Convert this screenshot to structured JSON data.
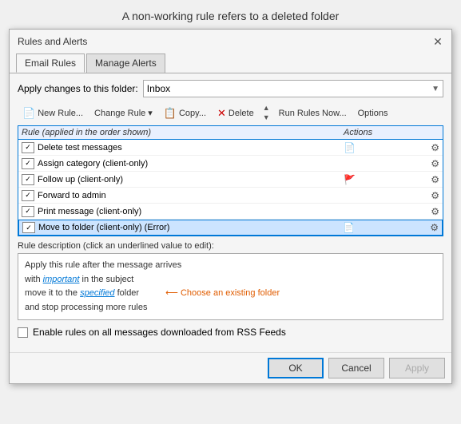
{
  "page": {
    "title": "A non-working rule refers to a deleted folder"
  },
  "dialog": {
    "title": "Rules and Alerts",
    "close_label": "✕"
  },
  "tabs": [
    {
      "id": "email-rules",
      "label": "Email Rules",
      "active": true
    },
    {
      "id": "manage-alerts",
      "label": "Manage Alerts",
      "active": false
    }
  ],
  "folder": {
    "label": "Apply changes to this folder:",
    "value": "Inbox"
  },
  "toolbar": {
    "new_rule": "New Rule...",
    "change_rule": "Change Rule",
    "copy": "Copy...",
    "delete": "Delete",
    "run_rules_now": "Run Rules Now...",
    "options": "Options"
  },
  "rules_table": {
    "header_rule": "Rule (applied in the order shown)",
    "header_actions": "Actions",
    "rows": [
      {
        "checked": true,
        "name": "Delete test messages",
        "has_action_icon": true,
        "has_settings": true,
        "flag": false,
        "error": false,
        "selected": false
      },
      {
        "checked": true,
        "name": "Assign category  (client-only)",
        "has_action_icon": false,
        "has_settings": true,
        "flag": false,
        "error": false,
        "selected": false
      },
      {
        "checked": true,
        "name": "Follow up  (client-only)",
        "has_action_icon": false,
        "has_settings": true,
        "flag": true,
        "error": false,
        "selected": false
      },
      {
        "checked": true,
        "name": "Forward to admin",
        "has_action_icon": false,
        "has_settings": true,
        "flag": false,
        "error": false,
        "selected": false
      },
      {
        "checked": true,
        "name": "Print message  (client-only)",
        "has_action_icon": false,
        "has_settings": true,
        "flag": false,
        "error": false,
        "selected": false
      },
      {
        "checked": true,
        "name": "Move to folder  (client-only)  (Error)",
        "has_action_icon": true,
        "has_settings": true,
        "flag": false,
        "error": true,
        "selected": true
      }
    ]
  },
  "description": {
    "label": "Rule description (click an underlined value to edit):",
    "lines": [
      "Apply this rule after the message arrives",
      "with important in the subject",
      "move it to the specified folder",
      "and stop processing more rules"
    ],
    "link1": "important",
    "link2": "specified",
    "annotation": "Choose an existing folder"
  },
  "rss": {
    "label": "Enable rules on all messages downloaded from RSS Feeds"
  },
  "buttons": {
    "ok": "OK",
    "cancel": "Cancel",
    "apply": "Apply"
  }
}
